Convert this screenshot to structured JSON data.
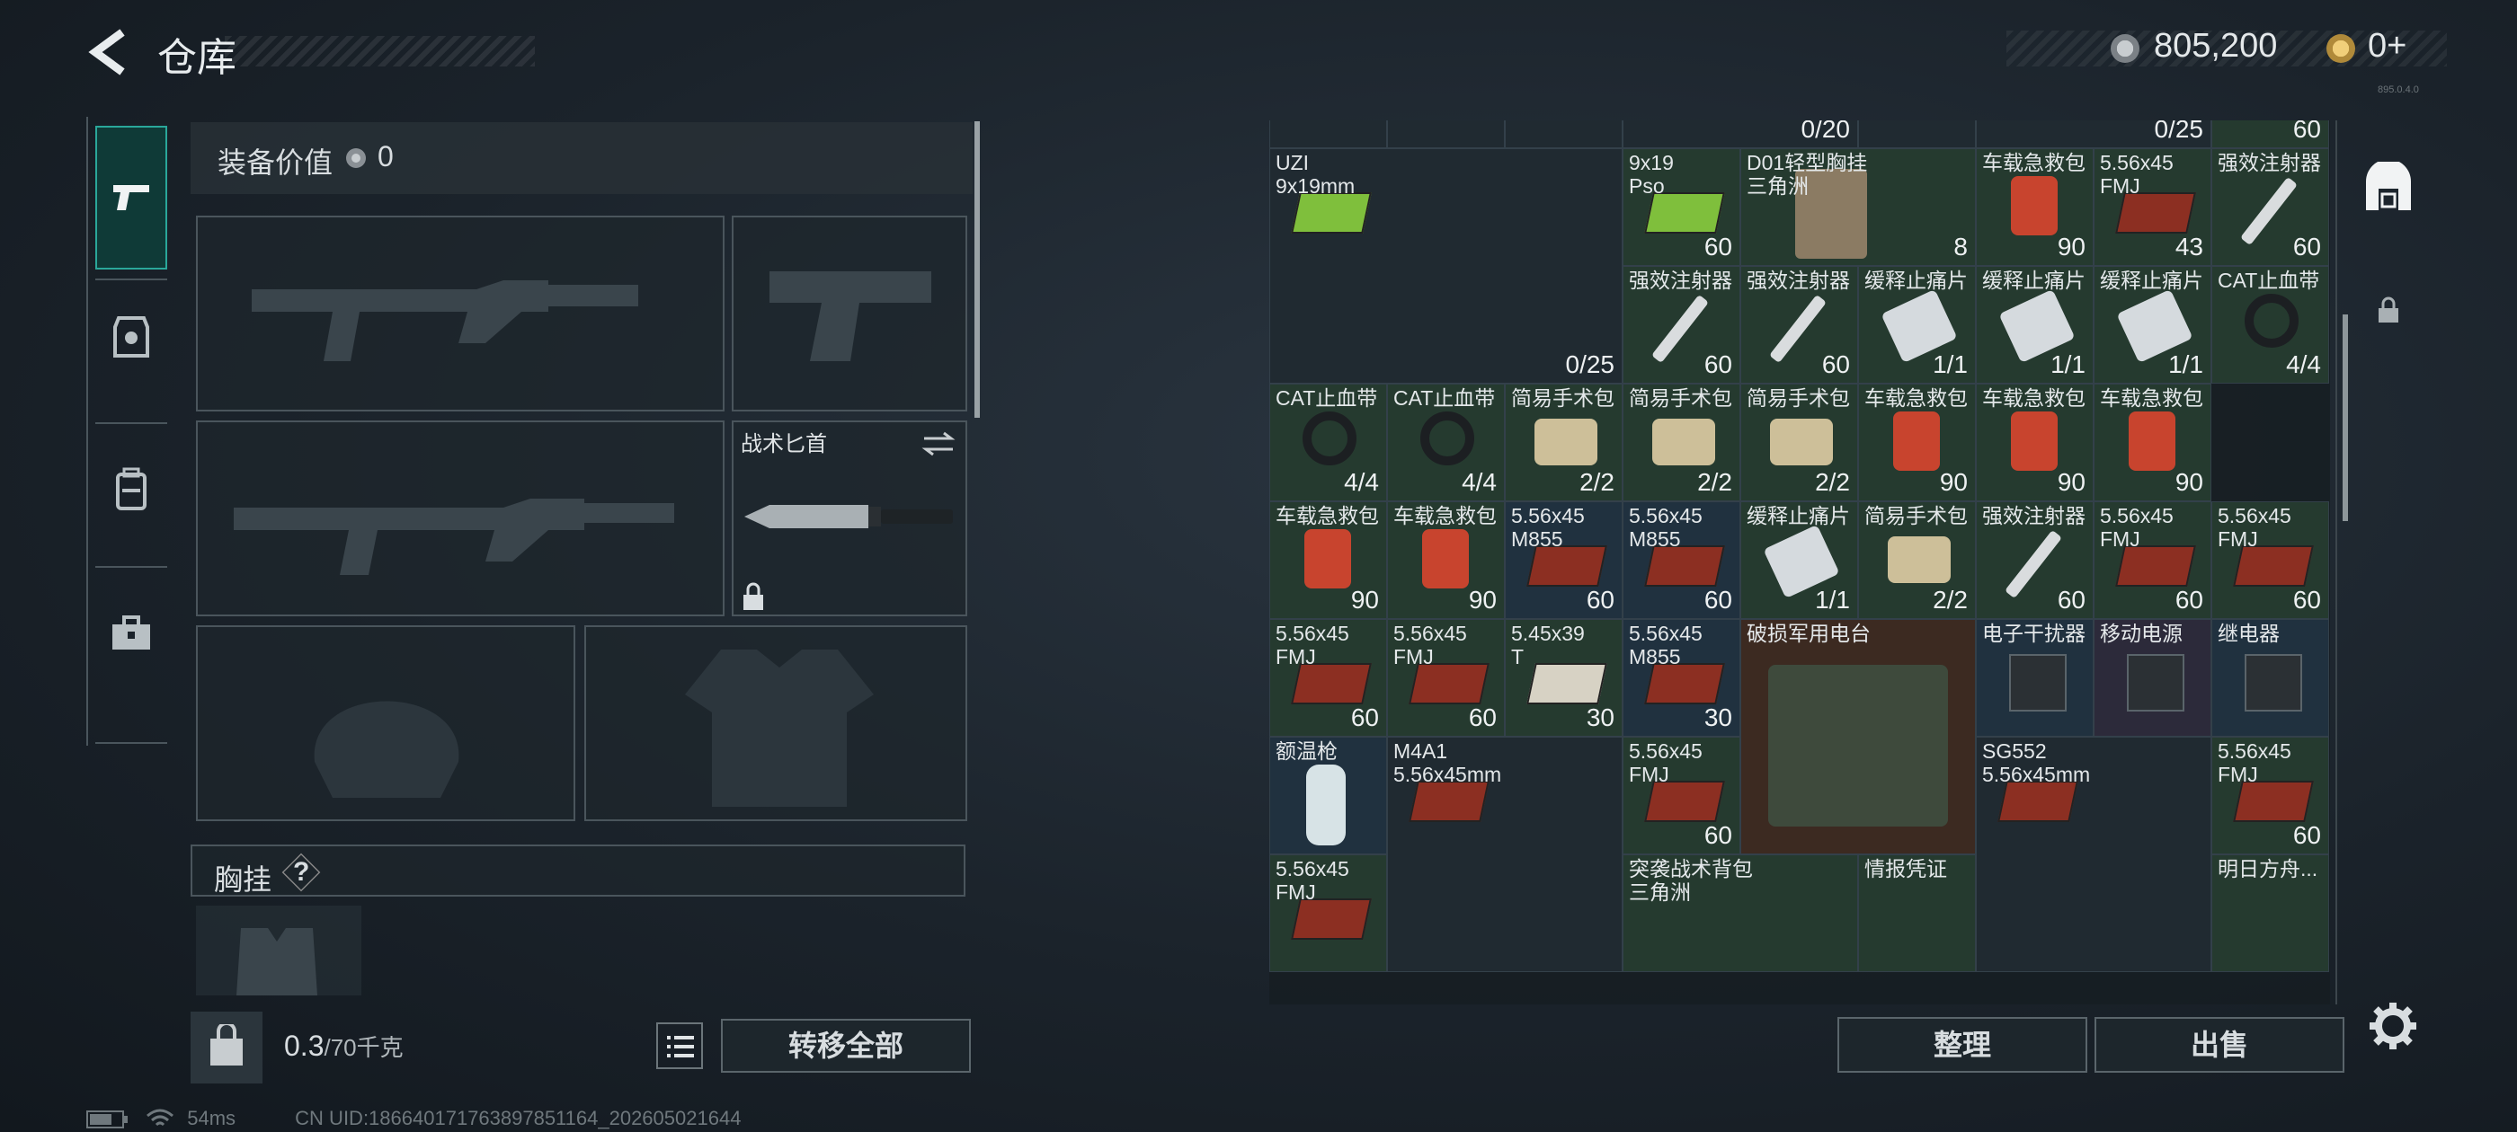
{
  "header": {
    "title": "仓库",
    "money": "805,200",
    "tokens": "0+",
    "version_text": "895.0.4.0"
  },
  "equipment": {
    "value_label": "装备价值",
    "value": "0",
    "knife_label": "战术匕首",
    "chest_label": "胸挂",
    "chest_help": "?"
  },
  "bottom": {
    "weight_value": "0.3",
    "weight_max": "/70千克",
    "transfer_label": "转移全部"
  },
  "actions": {
    "sort_label": "整理",
    "sell_label": "出售"
  },
  "status": {
    "ping": "54ms",
    "uid": "CN UID:1866401717638978511​64_202605021644"
  },
  "nav_icons": [
    "pistol-icon",
    "armor-icon",
    "backpack-icon",
    "case-icon"
  ],
  "grid": {
    "rows": [
      [
        {
          "name": "",
          "qty": "",
          "kind": "blank"
        },
        {
          "name": "",
          "qty": "",
          "kind": "blank"
        },
        {
          "name": "",
          "qty": "",
          "kind": "blank"
        },
        {
          "name": "",
          "qty": "0/20",
          "kind": "blank"
        },
        {
          "name": "",
          "qty": "",
          "kind": "blank"
        },
        {
          "name": "",
          "qty": "0/25",
          "kind": "blank"
        },
        {
          "name": "9x19\nPso",
          "qty": "60",
          "kind": "green"
        }
      ],
      [
        {
          "name": "UZI\n9x19mm",
          "qty": "0/25",
          "kind": "wide"
        },
        {
          "name": "9x19\nPso",
          "qty": "60",
          "kind": "green"
        },
        {
          "name": "D01轻型胸挂\n三角洲",
          "qty": "8",
          "kind": "green"
        },
        {
          "name": "车载急救包",
          "qty": "90",
          "kind": "green"
        },
        {
          "name": "5.56x45\nFMJ",
          "qty": "43",
          "kind": "green"
        },
        {
          "name": "强效注射器",
          "qty": "60",
          "kind": "green"
        }
      ],
      [
        {
          "name": "强效注射器",
          "qty": "60",
          "kind": "green"
        },
        {
          "name": "强效注射器",
          "qty": "60",
          "kind": "green"
        },
        {
          "name": "缓释止痛片",
          "qty": "1/1",
          "kind": "green"
        },
        {
          "name": "缓释止痛片",
          "qty": "1/1",
          "kind": "green"
        },
        {
          "name": "缓释止痛片",
          "qty": "1/1",
          "kind": "green"
        },
        {
          "name": "CAT止血带",
          "qty": "4/4",
          "kind": "green"
        }
      ],
      [
        {
          "name": "CAT止血带",
          "qty": "4/4",
          "kind": "green"
        },
        {
          "name": "CAT止血带",
          "qty": "4/4",
          "kind": "green"
        },
        {
          "name": "简易手术包",
          "qty": "2/2",
          "kind": "green"
        },
        {
          "name": "简易手术包",
          "qty": "2/2",
          "kind": "green"
        },
        {
          "name": "简易手术包",
          "qty": "2/2",
          "kind": "green"
        },
        {
          "name": "车载急救包",
          "qty": "90",
          "kind": "green"
        },
        {
          "name": "车载急救包",
          "qty": "90",
          "kind": "green"
        },
        {
          "name": "车载急救包",
          "qty": "90",
          "kind": "green"
        }
      ],
      [
        {
          "name": "车载急救包",
          "qty": "90",
          "kind": "green"
        },
        {
          "name": "车载急救包",
          "qty": "90",
          "kind": "green"
        },
        {
          "name": "5.56x45\nM855",
          "qty": "60",
          "kind": "blue"
        },
        {
          "name": "5.56x45\nM855",
          "qty": "60",
          "kind": "blue"
        },
        {
          "name": "缓释止痛片",
          "qty": "1/1",
          "kind": "green"
        },
        {
          "name": "简易手术包",
          "qty": "2/2",
          "kind": "green"
        },
        {
          "name": "强效注射器",
          "qty": "60",
          "kind": "green"
        },
        {
          "name": "5.56x45\nFMJ",
          "qty": "60",
          "kind": "green"
        },
        {
          "name": "5.56x45\nFMJ",
          "qty": "60",
          "kind": "green"
        }
      ],
      [
        {
          "name": "5.56x45\nFMJ",
          "qty": "60",
          "kind": "green"
        },
        {
          "name": "5.56x45\nFMJ",
          "qty": "60",
          "kind": "green"
        },
        {
          "name": "5.45x39\nT",
          "qty": "30",
          "kind": "green"
        },
        {
          "name": "5.56x45\nM855",
          "qty": "30",
          "kind": "blue"
        },
        {
          "name": "破损军用电台",
          "qty": "",
          "kind": "brown"
        },
        {
          "name": "电子干扰器",
          "qty": "",
          "kind": "blue"
        },
        {
          "name": "移动电源",
          "qty": "",
          "kind": "purple"
        },
        {
          "name": "继电器",
          "qty": "",
          "kind": "blue"
        }
      ],
      [
        {
          "name": "额温枪",
          "qty": "",
          "kind": "blue"
        },
        {
          "name": "M4A1\n5.56x45mm",
          "qty": "",
          "kind": "dark"
        },
        {
          "name": "5.56x45\nFMJ",
          "qty": "60",
          "kind": "green"
        },
        {
          "name": "SG552\n5.56x45mm",
          "qty": "",
          "kind": "dark"
        },
        {
          "name": "5.56x45\nFMJ",
          "qty": "60",
          "kind": "green"
        }
      ],
      [
        {
          "name": "5.56x45\nFMJ",
          "qty": "",
          "kind": "green"
        },
        {
          "name": "突袭战术背包\n三角洲",
          "qty": "",
          "kind": "green"
        },
        {
          "name": "情报凭证",
          "qty": "",
          "kind": "green"
        },
        {
          "name": "明日方舟...",
          "qty": "",
          "kind": "green"
        }
      ]
    ]
  },
  "colors": {
    "accent": "#2aa79a",
    "panel": "#1d262c",
    "medkit": "#c8442e"
  }
}
